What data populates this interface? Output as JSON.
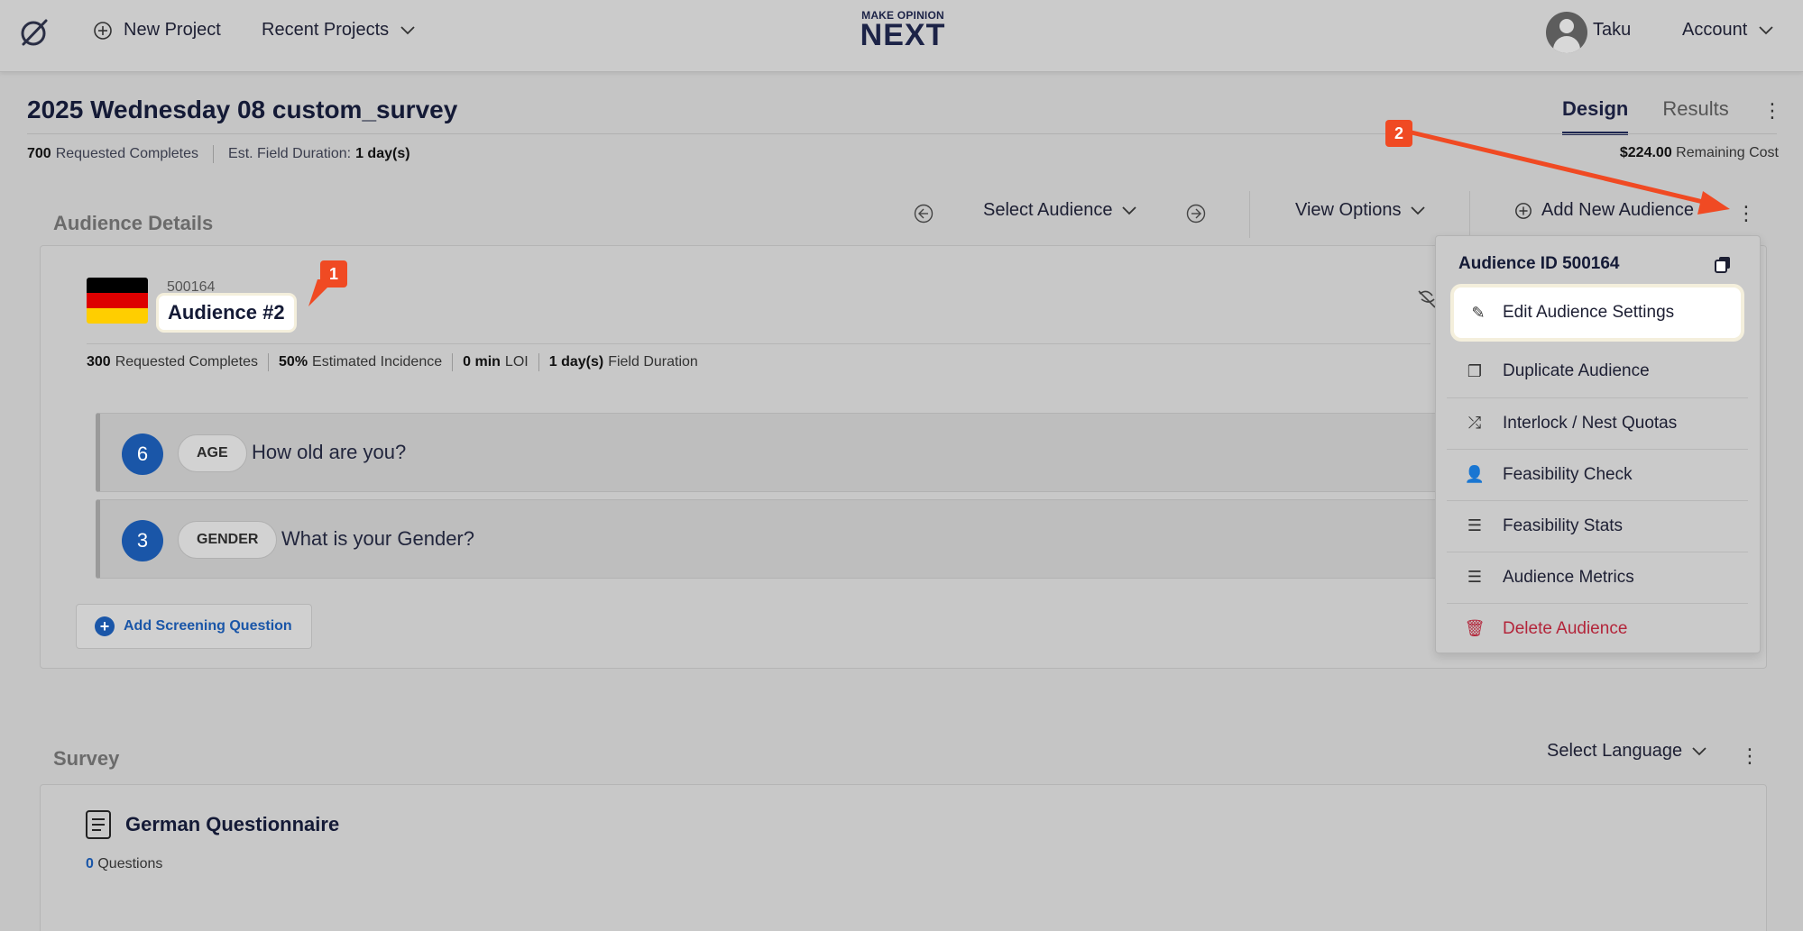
{
  "header": {
    "new_project": "New Project",
    "recent_projects": "Recent Projects",
    "brand_small": "MAKE OPINION",
    "brand_big": "NEXT",
    "user_name": "Taku",
    "account": "Account"
  },
  "project": {
    "title": "2025 Wednesday 08 custom_survey",
    "requested_completes_value": "700",
    "requested_completes_label": "Requested Completes",
    "field_duration_label": "Est. Field Duration:",
    "field_duration_value": "1 day(s)",
    "cost_value": "$224.00",
    "cost_label": "Remaining Cost"
  },
  "tabs": {
    "design": "Design",
    "results": "Results"
  },
  "audience_section": {
    "title": "Audience Details",
    "select_audience": "Select Audience",
    "view_options": "View Options",
    "add_new_audience": "Add New Audience"
  },
  "audience": {
    "id": "500164",
    "name": "Audience #2",
    "flag_colors": [
      "#000000",
      "#dd0000",
      "#ffce00"
    ],
    "meta": {
      "completes_value": "300",
      "completes_label": "Requested Completes",
      "incidence_value": "50%",
      "incidence_label": "Estimated Incidence",
      "loi_value": "0 min",
      "loi_label": "LOI",
      "duration_value": "1 day(s)",
      "duration_label": "Field Duration"
    },
    "questions": [
      {
        "count": "6",
        "tag": "AGE",
        "text": "How old are you?"
      },
      {
        "count": "3",
        "tag": "GENDER",
        "text": "What is your Gender?"
      }
    ],
    "add_screening": "Add Screening Question"
  },
  "menu": {
    "header": "Audience ID 500164",
    "items": [
      {
        "label": "Edit Audience Settings",
        "icon": "edit-icon"
      },
      {
        "label": "Duplicate Audience",
        "icon": "copy-icon"
      },
      {
        "label": "Interlock / Nest Quotas",
        "icon": "shuffle-icon"
      },
      {
        "label": "Feasibility Check",
        "icon": "user-check-icon"
      },
      {
        "label": "Feasibility Stats",
        "icon": "list-check-icon"
      },
      {
        "label": "Audience Metrics",
        "icon": "list-check-icon"
      },
      {
        "label": "Delete Audience",
        "icon": "trash-icon"
      }
    ]
  },
  "survey": {
    "title": "Survey",
    "select_language": "Select Language",
    "questionnaire_title": "German Questionnaire",
    "questions_count": "0",
    "questions_label": "Questions"
  },
  "annotations": {
    "badge_1": "1",
    "badge_2": "2"
  },
  "colors": {
    "accent_blue": "#1a56a8",
    "annotation": "#f04a23",
    "danger": "#b3253a"
  }
}
